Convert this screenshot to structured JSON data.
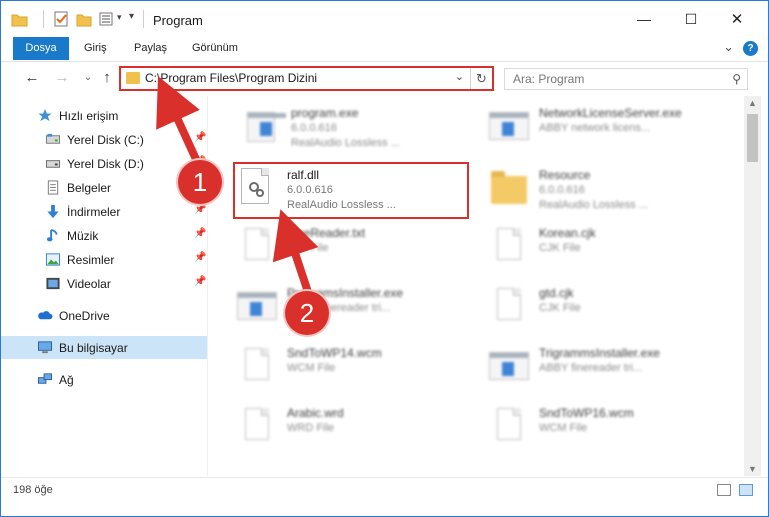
{
  "window": {
    "title": "Program",
    "controls": {
      "minimize": "—",
      "maximize": "☐",
      "close": "✕"
    }
  },
  "ribbon": {
    "tabs": [
      {
        "label": "Dosya",
        "active": true
      },
      {
        "label": "Giriş"
      },
      {
        "label": "Paylaş"
      },
      {
        "label": "Görünüm"
      }
    ],
    "help": "?",
    "collapse": "⌄"
  },
  "nav": {
    "address_path": "C:\\Program Files\\Program Dizini",
    "search_placeholder": "Ara: Program",
    "back": "←",
    "forward": "→",
    "recent": "⌄",
    "up": "↑",
    "refresh": "↻",
    "search_icon": "⚲"
  },
  "sidebar": {
    "items": [
      {
        "label": "Hızlı erişim",
        "icon": "star-icon"
      },
      {
        "label": "Yerel Disk (C:)",
        "icon": "drive-icon",
        "pinned": true
      },
      {
        "label": "Yerel Disk (D:)",
        "icon": "drive-icon",
        "pinned": true
      },
      {
        "label": "Belgeler",
        "icon": "documents-icon",
        "pinned": true
      },
      {
        "label": "İndirmeler",
        "icon": "download-icon",
        "pinned": true
      },
      {
        "label": "Müzik",
        "icon": "music-icon",
        "pinned": true
      },
      {
        "label": "Resimler",
        "icon": "pictures-icon",
        "pinned": true
      },
      {
        "label": "Videolar",
        "icon": "videos-icon",
        "pinned": true
      },
      {
        "label": "OneDrive",
        "icon": "cloud-icon"
      },
      {
        "label": "Bu bilgisayar",
        "icon": "computer-icon",
        "selected": true
      },
      {
        "label": "Ağ",
        "icon": "network-icon"
      }
    ]
  },
  "files": [
    {
      "name": "program.exe",
      "line1": "6.0.0.616",
      "line2": "RealAudio Lossless ...",
      "icon": "exe"
    },
    {
      "name": "NetworkLicenseServer.exe",
      "line1": "ABBY network licens...",
      "line2": "",
      "icon": "app"
    },
    {
      "name": "ralf.dll",
      "line1": "6.0.0.616",
      "line2": "RealAudio Lossless ...",
      "icon": "dll"
    },
    {
      "name": "Resource",
      "line1": "6.0.0.616",
      "line2": "RealAudio Lossless ...",
      "icon": "folder"
    },
    {
      "name": "FineReader.txt",
      "line1": "TXT File",
      "line2": "",
      "icon": "doc"
    },
    {
      "name": "Korean.cjk",
      "line1": "CJK File",
      "line2": "",
      "icon": "doc"
    },
    {
      "name": "ProgramsInstaller.exe",
      "line1": "ABBY finereader tri...",
      "line2": "",
      "icon": "app"
    },
    {
      "name": "gtd.cjk",
      "line1": "CJK File",
      "line2": "",
      "icon": "doc"
    },
    {
      "name": "SndToWP14.wcm",
      "line1": "WCM File",
      "line2": "",
      "icon": "doc"
    },
    {
      "name": "TrigrammsInstaller.exe",
      "line1": "ABBY finereader tri...",
      "line2": "",
      "icon": "app"
    },
    {
      "name": "Arabic.wrd",
      "line1": "WRD File",
      "line2": "",
      "icon": "doc"
    },
    {
      "name": "SndToWP16.wcm",
      "line1": "WCM File",
      "line2": "",
      "icon": "doc"
    }
  ],
  "status": {
    "count": "198 öğe"
  },
  "callouts": {
    "one": "1",
    "two": "2"
  },
  "colors": {
    "accent": "#1979ca",
    "highlight": "#d9302c",
    "selection": "#cce4f7",
    "folder": "#f2c14b"
  }
}
